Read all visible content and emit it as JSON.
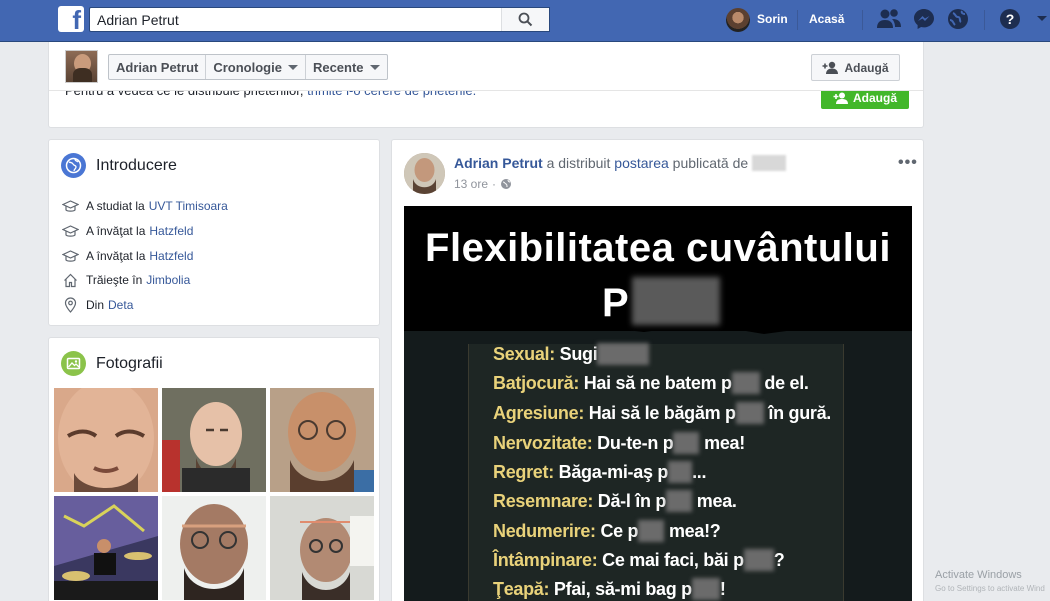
{
  "topbar": {
    "logo": "f",
    "search_value": "Adrian Petrut",
    "user_name": "Sorin",
    "home": "Acasă",
    "icons": [
      "friend-requests-icon",
      "messenger-icon",
      "notifications-globe-icon",
      "help-icon"
    ]
  },
  "cover": {
    "breadcrumb": [
      "Adrian Petrut",
      "Cronologie",
      "Recente"
    ],
    "add_button": "Adaugă",
    "notice_text": "Pentru a vedea ce le distribuie prietenilor,",
    "notice_link": "trimite i-o cerere de prietenie.",
    "add_friend_button": "Adaugă"
  },
  "intro": {
    "title": "Introducere",
    "rows": [
      {
        "icon": "education-icon",
        "prefix": "A studiat la",
        "link": "UVT Timisoara"
      },
      {
        "icon": "education-icon",
        "prefix": "A învăţat la",
        "link": "Hatzfeld"
      },
      {
        "icon": "education-icon",
        "prefix": "A învăţat la",
        "link": "Hatzfeld"
      },
      {
        "icon": "home-icon",
        "prefix": "Trăieşte în",
        "link": "Jimbolia"
      },
      {
        "icon": "location-pin-icon",
        "prefix": "Din",
        "link": "Deta"
      }
    ]
  },
  "photos": {
    "title": "Fotografii"
  },
  "post": {
    "author": "Adrian Petrut",
    "action": "a distribuit",
    "link": "postarea",
    "suffix": "publicată de",
    "time": "13 ore",
    "meme": {
      "title_line1": "Flexibilitatea cuvântului",
      "title_line2_letter": "P",
      "lines": [
        {
          "key": "Sexual:",
          "text": "Sugi"
        },
        {
          "key": "Batjocură:",
          "text": "Hai să ne batem p",
          "after": "de el."
        },
        {
          "key": "Agresiune:",
          "text": "Hai să le băgăm p",
          "after": "în gură."
        },
        {
          "key": "Nervozitate:",
          "text": "Du-te-n p",
          "after": "mea!"
        },
        {
          "key": "Regret:",
          "text": "Băga-mi-aş p",
          "after": "..."
        },
        {
          "key": "Resemnare:",
          "text": "Dă-l în p",
          "after": "mea."
        },
        {
          "key": "Nedumerire:",
          "text": "Ce p",
          "after": "mea!?"
        },
        {
          "key": "Întâmpinare:",
          "text": "Ce mai faci, băi p",
          "after": "?"
        },
        {
          "key": "Ţeapă:",
          "text": "Pfai, să-mi bag p",
          "after": "!"
        }
      ]
    }
  },
  "watermark": {
    "line1": "Activate Windows",
    "line2": "Go to Settings to activate Wind"
  }
}
